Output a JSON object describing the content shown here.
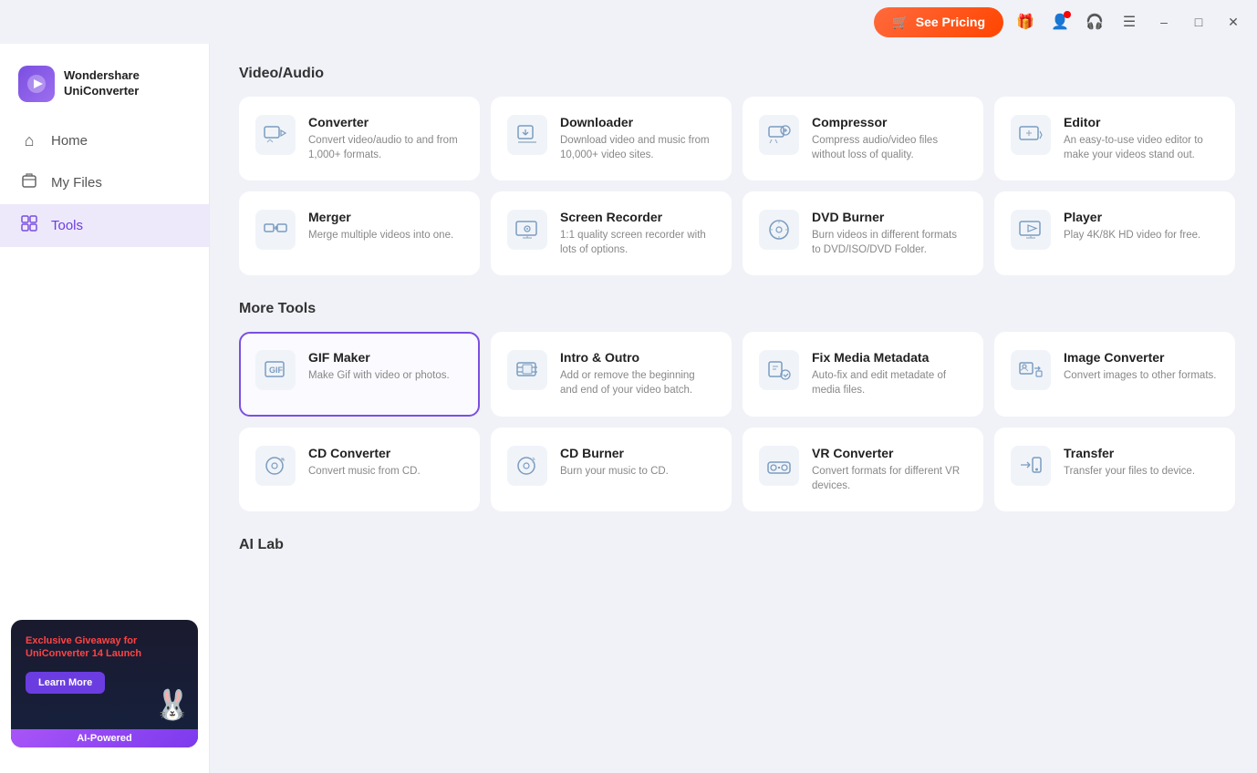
{
  "titlebar": {
    "see_pricing_label": "See Pricing",
    "minimize_label": "–",
    "maximize_label": "□",
    "close_label": "✕"
  },
  "sidebar": {
    "brand_name": "Wondershare\nUniConverter",
    "brand_icon": "▶",
    "nav_items": [
      {
        "id": "home",
        "label": "Home",
        "icon": "⌂",
        "active": false
      },
      {
        "id": "my-files",
        "label": "My Files",
        "icon": "📁",
        "active": false
      },
      {
        "id": "tools",
        "label": "Tools",
        "icon": "🧰",
        "active": true
      }
    ],
    "promo": {
      "title": "Exclusive Giveaway for\nUniConverter 14 Launch",
      "learn_more_label": "Learn More",
      "ai_badge": "AI-Powered"
    }
  },
  "main": {
    "sections": [
      {
        "id": "video-audio",
        "title": "Video/Audio",
        "tools": [
          {
            "id": "converter",
            "name": "Converter",
            "desc": "Convert video/audio to and from 1,000+ formats.",
            "icon": "converter"
          },
          {
            "id": "downloader",
            "name": "Downloader",
            "desc": "Download video and music from 10,000+ video sites.",
            "icon": "downloader"
          },
          {
            "id": "compressor",
            "name": "Compressor",
            "desc": "Compress audio/video files without loss of quality.",
            "icon": "compressor"
          },
          {
            "id": "editor",
            "name": "Editor",
            "desc": "An easy-to-use video editor to make your videos stand out.",
            "icon": "editor"
          },
          {
            "id": "merger",
            "name": "Merger",
            "desc": "Merge multiple videos into one.",
            "icon": "merger"
          },
          {
            "id": "screen-recorder",
            "name": "Screen Recorder",
            "desc": "1:1 quality screen recorder with lots of options.",
            "icon": "screen-recorder"
          },
          {
            "id": "dvd-burner",
            "name": "DVD Burner",
            "desc": "Burn videos in different formats to DVD/ISO/DVD Folder.",
            "icon": "dvd-burner"
          },
          {
            "id": "player",
            "name": "Player",
            "desc": "Play 4K/8K HD video for free.",
            "icon": "player"
          }
        ]
      },
      {
        "id": "more-tools",
        "title": "More Tools",
        "tools": [
          {
            "id": "gif-maker",
            "name": "GIF Maker",
            "desc": "Make Gif with video or photos.",
            "icon": "gif-maker",
            "active": true
          },
          {
            "id": "intro-outro",
            "name": "Intro & Outro",
            "desc": "Add or remove the beginning and end of your video batch.",
            "icon": "intro-outro"
          },
          {
            "id": "fix-media-metadata",
            "name": "Fix Media Metadata",
            "desc": "Auto-fix and edit metadate of media files.",
            "icon": "fix-media-metadata"
          },
          {
            "id": "image-converter",
            "name": "Image Converter",
            "desc": "Convert images to other formats.",
            "icon": "image-converter"
          },
          {
            "id": "cd-converter",
            "name": "CD Converter",
            "desc": "Convert music from CD.",
            "icon": "cd-converter"
          },
          {
            "id": "cd-burner",
            "name": "CD Burner",
            "desc": "Burn your music to CD.",
            "icon": "cd-burner"
          },
          {
            "id": "vr-converter",
            "name": "VR Converter",
            "desc": "Convert formats for different VR devices.",
            "icon": "vr-converter"
          },
          {
            "id": "transfer",
            "name": "Transfer",
            "desc": "Transfer your files to device.",
            "icon": "transfer"
          }
        ]
      },
      {
        "id": "ai-lab",
        "title": "AI Lab",
        "tools": []
      }
    ]
  }
}
